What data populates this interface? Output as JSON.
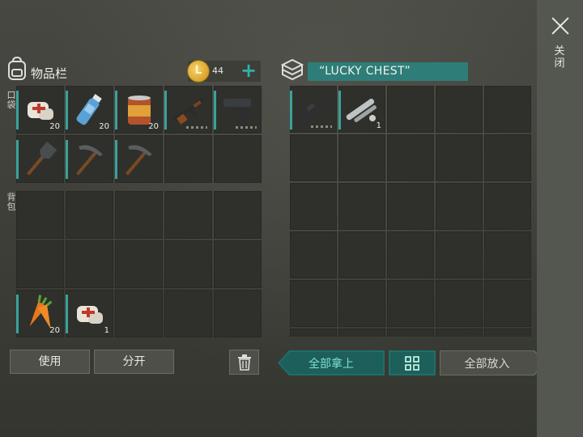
{
  "inventory": {
    "title": "物品栏",
    "coins": "44",
    "coin_symbol": "L",
    "coin_add": "+",
    "pocket_label": "口袋",
    "backpack_label": "背包",
    "pocket_slots": [
      {
        "item": "first-aid-kit",
        "qty": "20"
      },
      {
        "item": "water-bottle",
        "qty": "20"
      },
      {
        "item": "canned-food",
        "qty": "20"
      },
      {
        "item": "ak-rifle",
        "qty": "",
        "durability": true
      },
      {
        "item": "pistol",
        "qty": "",
        "durability": true
      },
      {
        "item": "shovel",
        "qty": ""
      },
      {
        "item": "pickaxe",
        "qty": ""
      },
      {
        "item": "pickaxe",
        "qty": ""
      },
      {
        "item": "",
        "qty": ""
      },
      {
        "item": "",
        "qty": ""
      }
    ],
    "backpack_slots": [
      {
        "item": "",
        "qty": ""
      },
      {
        "item": "",
        "qty": ""
      },
      {
        "item": "",
        "qty": ""
      },
      {
        "item": "",
        "qty": ""
      },
      {
        "item": "",
        "qty": ""
      },
      {
        "item": "",
        "qty": ""
      },
      {
        "item": "",
        "qty": ""
      },
      {
        "item": "",
        "qty": ""
      },
      {
        "item": "",
        "qty": ""
      },
      {
        "item": "",
        "qty": ""
      },
      {
        "item": "carrot",
        "qty": "20"
      },
      {
        "item": "first-aid-kit",
        "qty": "1"
      },
      {
        "item": "",
        "qty": ""
      },
      {
        "item": "",
        "qty": ""
      },
      {
        "item": "",
        "qty": ""
      }
    ],
    "use_label": "使用",
    "split_label": "分开"
  },
  "chest": {
    "name": "“LUCKY CHEST”",
    "slots": [
      {
        "item": "m16-rifle",
        "qty": "",
        "durability": true
      },
      {
        "item": "pipe-parts",
        "qty": "1"
      },
      {
        "item": "",
        "qty": ""
      },
      {
        "item": "",
        "qty": ""
      },
      {
        "item": "",
        "qty": ""
      }
    ],
    "take_all_label": "全部拿上",
    "put_all_label": "全部放入"
  },
  "close_label": "关闭",
  "colors": {
    "accent": "#2e7d78",
    "coin": "#d9a22c",
    "slot": "#2f302b"
  }
}
